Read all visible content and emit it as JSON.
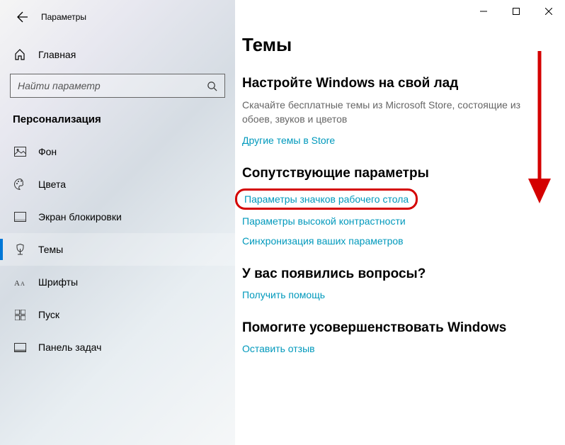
{
  "titlebar": {
    "app_name": "Параметры"
  },
  "sidebar": {
    "home_label": "Главная",
    "search_placeholder": "Найти параметр",
    "section": "Персонализация",
    "items": [
      {
        "label": "Фон",
        "icon": "image"
      },
      {
        "label": "Цвета",
        "icon": "palette"
      },
      {
        "label": "Экран блокировки",
        "icon": "lock-screen"
      },
      {
        "label": "Темы",
        "icon": "themes",
        "selected": true
      },
      {
        "label": "Шрифты",
        "icon": "fonts"
      },
      {
        "label": "Пуск",
        "icon": "start"
      },
      {
        "label": "Панель задач",
        "icon": "taskbar"
      }
    ]
  },
  "content": {
    "title": "Темы",
    "customize": {
      "heading": "Настройте Windows на свой лад",
      "desc": "Скачайте бесплатные темы из Microsoft Store, состоящие из обоев, звуков и цветов",
      "link": "Другие темы в Store"
    },
    "related": {
      "heading": "Сопутствующие параметры",
      "links": [
        "Параметры значков рабочего стола",
        "Параметры высокой контрастности",
        "Синхронизация ваших параметров"
      ]
    },
    "help": {
      "heading": "У вас появились вопросы?",
      "link": "Получить помощь"
    },
    "feedback": {
      "heading": "Помогите усовершенствовать Windows",
      "link": "Оставить отзыв"
    }
  }
}
